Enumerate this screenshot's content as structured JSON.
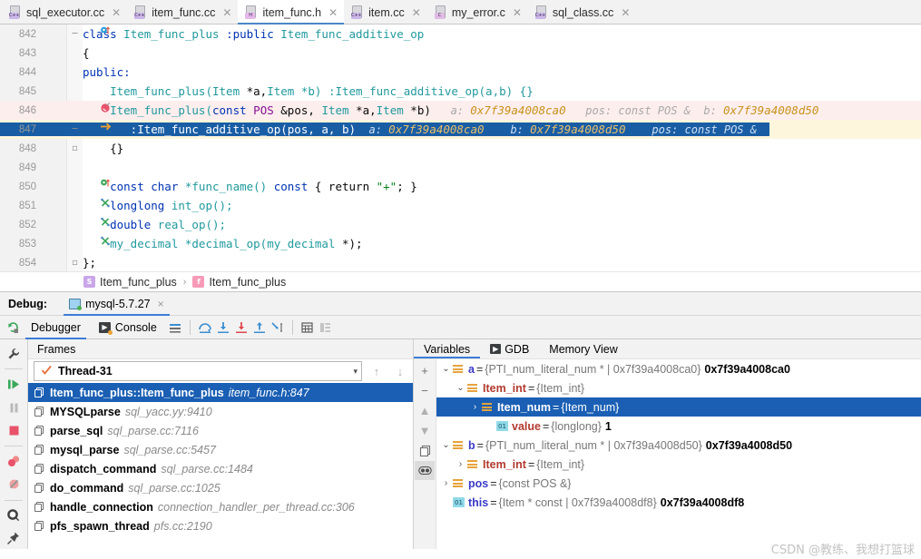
{
  "tabs": [
    {
      "label": "sql_executor.cc",
      "kind": "cpp",
      "badge": "C++",
      "active": false
    },
    {
      "label": "item_func.cc",
      "kind": "cpp",
      "badge": "C++",
      "active": false
    },
    {
      "label": "item_func.h",
      "kind": "h",
      "badge": "H",
      "active": true
    },
    {
      "label": "item.cc",
      "kind": "cpp",
      "badge": "C++",
      "active": false
    },
    {
      "label": "my_error.c",
      "kind": "c",
      "badge": "C",
      "active": false
    },
    {
      "label": "sql_class.cc",
      "kind": "cpp",
      "badge": "C++",
      "active": false
    }
  ],
  "editor": {
    "lines": [
      {
        "num": "842",
        "gutter_icon": "breakpoint-method-blue",
        "fold": "collapse",
        "highlight": "none"
      },
      {
        "num": "843",
        "gutter_icon": "",
        "fold": "",
        "highlight": "none"
      },
      {
        "num": "844",
        "gutter_icon": "",
        "fold": "",
        "highlight": "none"
      },
      {
        "num": "845",
        "gutter_icon": "",
        "fold": "",
        "highlight": "none"
      },
      {
        "num": "846",
        "gutter_icon": "breakpoint-red",
        "fold": "",
        "highlight": "pink"
      },
      {
        "num": "847",
        "gutter_icon": "execution-arrow",
        "fold": "collapse",
        "highlight": "exec"
      },
      {
        "num": "848",
        "gutter_icon": "",
        "fold": "fold-end",
        "highlight": "none"
      },
      {
        "num": "849",
        "gutter_icon": "",
        "fold": "",
        "highlight": "none"
      },
      {
        "num": "850",
        "gutter_icon": "breakpoint-method-green",
        "fold": "",
        "highlight": "none"
      },
      {
        "num": "851",
        "gutter_icon": "implemented-mark",
        "fold": "",
        "highlight": "none"
      },
      {
        "num": "852",
        "gutter_icon": "implemented-mark",
        "fold": "",
        "highlight": "none"
      },
      {
        "num": "853",
        "gutter_icon": "implemented-mark",
        "fold": "",
        "highlight": "none"
      },
      {
        "num": "854",
        "gutter_icon": "",
        "fold": "fold-end",
        "highlight": "none"
      }
    ],
    "code": {
      "l842_kw": "class",
      "l842_name": " Item_func_plus ",
      "l842_public": ":public",
      "l842_base": " Item_func_additive_op",
      "l843": "{",
      "l844": "public:",
      "l845_fn": "    Item_func_plus(",
      "l845_t1": "Item",
      "l845_a": " *a,",
      "l845_t2": "Item",
      "l845_b": " *b) :Item_func_additive_op(a,b) {}",
      "l846_fn": "    Item_func_plus(",
      "l846_const": "const",
      "l846_pos": " POS",
      "l846_amp": " &pos, ",
      "l846_t1": "Item",
      "l846_a": " *a,",
      "l846_t2": "Item",
      "l846_b": " *b)",
      "l846_h1": "a:",
      "l846_v1": "0x7f39a4008ca0",
      "l846_h2": "pos: const POS &",
      "l846_h3": "b:",
      "l846_v3": "0x7f39a4008d50",
      "l847_code": "       :Item_func_additive_op(pos, a, b)",
      "l847_h1": "a:",
      "l847_v1": "0x7f39a4008ca0",
      "l847_h2": "b:",
      "l847_v2": "0x7f39a4008d50",
      "l847_h3": "pos: const POS &",
      "l848": "    {}",
      "l850_kw": "    const char",
      "l850_fn": " *func_name() ",
      "l850_kw2": "const",
      "l850_body": " { return ",
      "l850_str": "\"+\"",
      "l850_end": "; }",
      "l851_t": "    longlong",
      "l851_fn": " int_op();",
      "l852_t": "    double",
      "l852_fn": " real_op();",
      "l853_t": "    my_decimal",
      "l853_fn": " *decimal_op(",
      "l853_t2": "my_decimal",
      "l853_end": " *);",
      "l854": "};"
    }
  },
  "breadcrumb": {
    "class_icon": "S",
    "class_name": "Item_func_plus",
    "separator": "›",
    "func_icon": "f",
    "func_name": "Item_func_plus"
  },
  "debug_header": {
    "label": "Debug:",
    "config_name": "mysql-5.7.27",
    "close": "×"
  },
  "debug_toolbar": {
    "rerun_icon": "rerun-icon",
    "tabs": [
      {
        "label": "Debugger",
        "icon": "",
        "active": true
      },
      {
        "label": "Console",
        "icon": "console-icon",
        "active": false
      }
    ],
    "buttons": [
      "show-execution-point-icon",
      "step-over-icon",
      "step-into-icon",
      "force-step-into-icon",
      "step-out-icon",
      "run-to-cursor-icon",
      "evaluate-expression-icon",
      "layout-settings-icon"
    ]
  },
  "vtoolbar": [
    "wrench-icon",
    "resume-program-icon",
    "pause-program-icon",
    "stop-icon",
    "view-breakpoints-icon",
    "mute-breakpoints-icon",
    "settings-icon",
    "pin-icon"
  ],
  "frames": {
    "title": "Frames",
    "thread": {
      "name": "Thread-31",
      "status_icon": "check-icon",
      "caret": "▾"
    },
    "nav": {
      "up": "↑",
      "down": "↓"
    },
    "items": [
      {
        "name": "Item_func_plus::Item_func_plus",
        "location": "item_func.h:847",
        "selected": true
      },
      {
        "name": "MYSQLparse",
        "location": "sql_yacc.yy:9410",
        "selected": false
      },
      {
        "name": "parse_sql",
        "location": "sql_parse.cc:7116",
        "selected": false
      },
      {
        "name": "mysql_parse",
        "location": "sql_parse.cc:5457",
        "selected": false
      },
      {
        "name": "dispatch_command",
        "location": "sql_parse.cc:1484",
        "selected": false
      },
      {
        "name": "do_command",
        "location": "sql_parse.cc:1025",
        "selected": false
      },
      {
        "name": "handle_connection",
        "location": "connection_handler_per_thread.cc:306",
        "selected": false
      },
      {
        "name": "pfs_spawn_thread",
        "location": "pfs.cc:2190",
        "selected": false
      }
    ]
  },
  "variables": {
    "tabs": [
      {
        "label": "Variables",
        "icon": "",
        "active": true
      },
      {
        "label": "GDB",
        "icon": "gdb-icon",
        "active": false
      },
      {
        "label": "Memory View",
        "icon": "",
        "active": false
      }
    ],
    "side_buttons": [
      "add-icon",
      "remove-icon",
      "up-icon",
      "down-icon",
      "copy-icon",
      "watches-icon"
    ],
    "rows": [
      {
        "indent": 0,
        "twisty": "⌄",
        "icon": "object-icon",
        "name": "a",
        "name_color": "blue",
        "type": "{PTI_num_literal_num * | 0x7f39a4008ca0}",
        "value": "0x7f39a4008ca0",
        "selected": false
      },
      {
        "indent": 1,
        "twisty": "⌄",
        "icon": "object-icon",
        "name": "Item_int",
        "name_color": "red",
        "type": "{Item_int}",
        "value": "",
        "selected": false
      },
      {
        "indent": 2,
        "twisty": "›",
        "icon": "object-icon",
        "name": "Item_num",
        "name_color": "plain",
        "type": "{Item_num}",
        "value": "",
        "selected": true
      },
      {
        "indent": 3,
        "twisty": "",
        "icon": "primitive-icon",
        "name": "value",
        "name_color": "red",
        "type": "{longlong}",
        "value": "1",
        "selected": false
      },
      {
        "indent": 0,
        "twisty": "⌄",
        "icon": "object-icon",
        "name": "b",
        "name_color": "blue",
        "type": "{PTI_num_literal_num * | 0x7f39a4008d50}",
        "value": "0x7f39a4008d50",
        "selected": false
      },
      {
        "indent": 1,
        "twisty": "›",
        "icon": "object-icon",
        "name": "Item_int",
        "name_color": "red",
        "type": "{Item_int}",
        "value": "",
        "selected": false
      },
      {
        "indent": 0,
        "twisty": "›",
        "icon": "object-icon",
        "name": "pos",
        "name_color": "blue",
        "type": "{const POS &}",
        "value": "",
        "selected": false
      },
      {
        "indent": 0,
        "twisty": "",
        "icon": "primitive-icon",
        "name": "this",
        "name_color": "blue",
        "type": "{Item * const | 0x7f39a4008df8}",
        "value": "0x7f39a4008df8",
        "selected": false
      }
    ]
  },
  "watermark": "CSDN @教练、我想打篮球",
  "colors": {
    "selection_blue": "#1a5fb4",
    "exec_line_blue": "#195da5",
    "breakpoint_line_pink": "#fdeeee",
    "exec_gutter_yellow": "#fdf6dd",
    "tab_underline": "#3b7dd8"
  }
}
